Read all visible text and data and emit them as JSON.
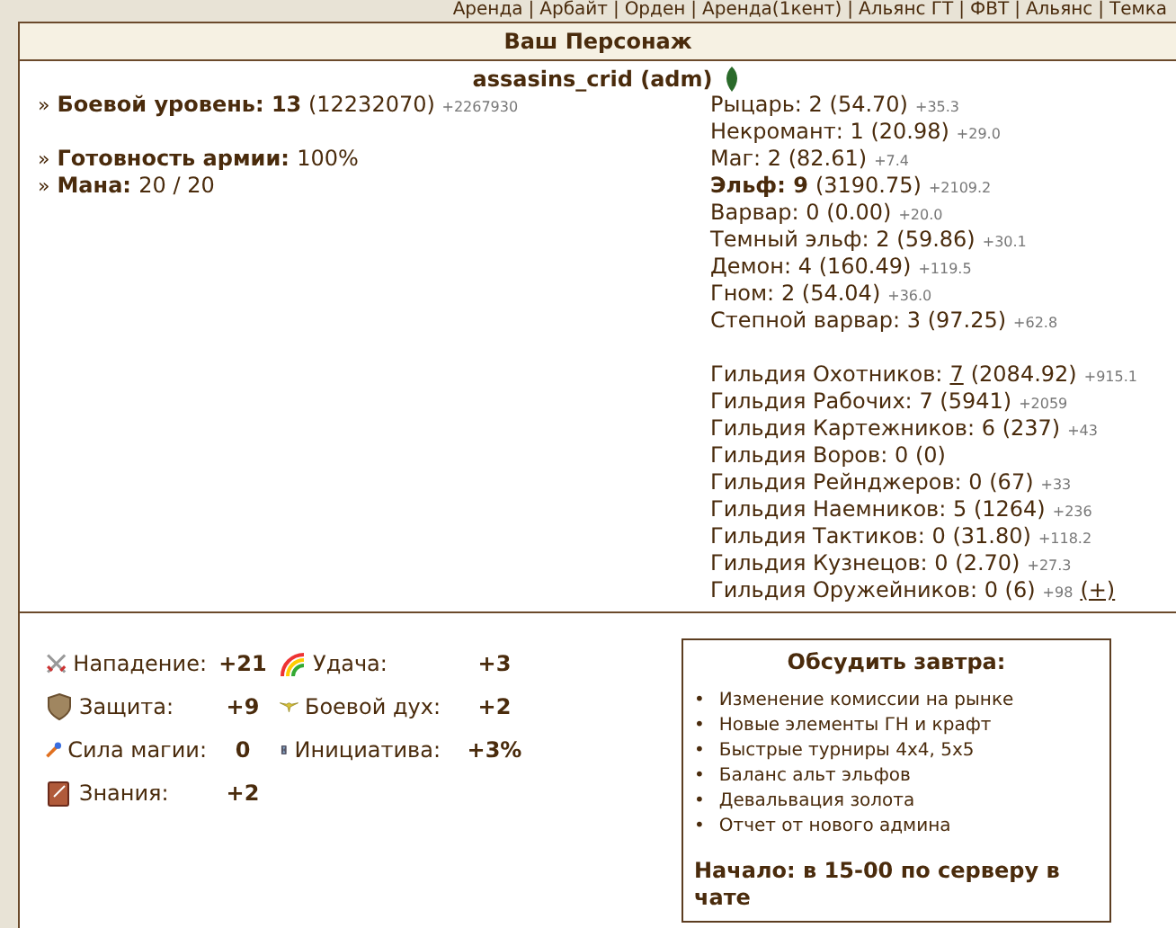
{
  "nav": [
    "Аренда",
    "Арбайт",
    "Орден",
    "Аренда(1кент)",
    "Альянс ГТ",
    "ФВТ",
    "Альянс",
    "Темка"
  ],
  "nav_separator": "|",
  "stat_marker": "»",
  "agenda_bullet": "•",
  "title": "Ваш Персонаж",
  "character": {
    "name": "assasins_crid (adm)"
  },
  "stat_groups": [
    [
      {
        "label": "Боевой уровень:",
        "value": "13",
        "detail": "(12232070)",
        "delta": "+2267930"
      }
    ],
    [
      {
        "label": "Готовность армии:",
        "value": "100%"
      },
      {
        "label": "Мана:",
        "value": "20 / 20"
      }
    ]
  ],
  "factions": [
    {
      "label": "Рыцарь:",
      "level": "2",
      "detail": "(54.70)",
      "delta": "+35.3",
      "bold": false
    },
    {
      "label": "Некромант:",
      "level": "1",
      "detail": "(20.98)",
      "delta": "+29.0",
      "bold": false
    },
    {
      "label": "Маг:",
      "level": "2",
      "detail": "(82.61)",
      "delta": "+7.4",
      "bold": false
    },
    {
      "label": "Эльф:",
      "level": "9",
      "detail": "(3190.75)",
      "delta": "+2109.2",
      "bold": true
    },
    {
      "label": "Варвар:",
      "level": "0",
      "detail": "(0.00)",
      "delta": "+20.0",
      "bold": false
    },
    {
      "label": "Темный эльф:",
      "level": "2",
      "detail": "(59.86)",
      "delta": "+30.1",
      "bold": false
    },
    {
      "label": "Демон:",
      "level": "4",
      "detail": "(160.49)",
      "delta": "+119.5",
      "bold": false
    },
    {
      "label": "Гном:",
      "level": "2",
      "detail": "(54.04)",
      "delta": "+36.0",
      "bold": false
    },
    {
      "label": "Степной варвар:",
      "level": "3",
      "detail": "(97.25)",
      "delta": "+62.8",
      "bold": false
    }
  ],
  "guilds": [
    {
      "label": "Гильдия Охотников:",
      "level": "7",
      "detail": "(2084.92)",
      "delta": "+915.1",
      "linked": true
    },
    {
      "label": "Гильдия Рабочих:",
      "level": "7",
      "detail": "(5941)",
      "delta": "+2059",
      "linked": false
    },
    {
      "label": "Гильдия Картежников:",
      "level": "6",
      "detail": "(237)",
      "delta": "+43",
      "linked": false
    },
    {
      "label": "Гильдия Воров:",
      "level": "0",
      "detail": "(0)",
      "linked": false
    },
    {
      "label": "Гильдия Рейнджеров:",
      "level": "0",
      "detail": "(67)",
      "delta": "+33",
      "linked": false
    },
    {
      "label": "Гильдия Наемников:",
      "level": "5",
      "detail": "(1264)",
      "delta": "+236",
      "linked": false
    },
    {
      "label": "Гильдия Тактиков:",
      "level": "0",
      "detail": "(31.80)",
      "delta": "+118.2",
      "linked": false
    },
    {
      "label": "Гильдия Кузнецов:",
      "level": "0",
      "detail": "(2.70)",
      "delta": "+27.3",
      "linked": false
    },
    {
      "label": "Гильдия Оружейников:",
      "level": "0",
      "detail": "(6)",
      "delta": "+98",
      "linked": false,
      "action": "(+)"
    }
  ],
  "skills": [
    {
      "kind": "attack",
      "label": "Нападение:",
      "value": "+21"
    },
    {
      "kind": "luck",
      "label": "Удача:",
      "value": "+3"
    },
    {
      "kind": "defense",
      "label": "Защита:",
      "value": "+9"
    },
    {
      "kind": "morale",
      "label": "Боевой дух:",
      "value": "+2"
    },
    {
      "kind": "magic",
      "label": "Сила магии:",
      "value": "0"
    },
    {
      "kind": "initiative",
      "label": "Инициатива:",
      "value": "+3%"
    },
    {
      "kind": "knowledge",
      "label": "Знания:",
      "value": "+2"
    }
  ],
  "agenda": {
    "title": "Обсудить завтра:",
    "items": [
      "Изменение комиссии на рынке",
      "Новые элементы ГН и крафт",
      "Быстрые турниры 4x4, 5x5",
      "Баланс альт эльфов",
      "Девальвация золота",
      "Отчет от нового админа"
    ],
    "footer": "Начало: в 15-00 по серверу в чате"
  }
}
